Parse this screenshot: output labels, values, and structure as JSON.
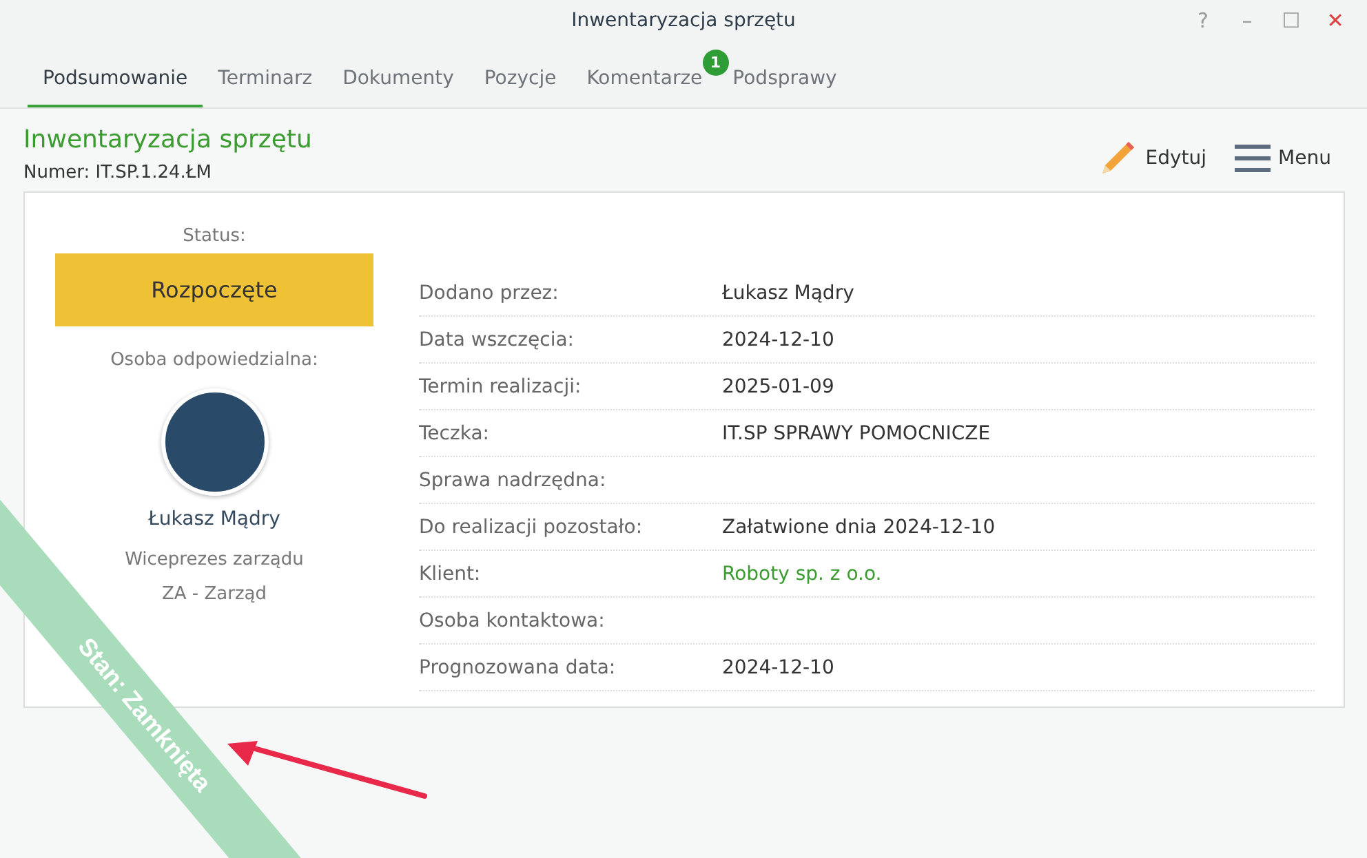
{
  "window": {
    "title": "Inwentaryzacja sprzętu",
    "controls": [
      "?",
      "–",
      "☐",
      "✕"
    ]
  },
  "tabs": [
    {
      "label": "Podsumowanie",
      "selected": true
    },
    {
      "label": "Terminarz",
      "selected": false
    },
    {
      "label": "Dokumenty",
      "selected": false
    },
    {
      "label": "Pozycje",
      "selected": false
    },
    {
      "label": "Komentarze",
      "selected": false,
      "badge": "1"
    },
    {
      "label": "Podsprawy",
      "selected": false
    }
  ],
  "header": {
    "title": "Inwentaryzacja sprzętu",
    "number": "Numer: IT.SP.1.24.ŁM",
    "actions": [
      {
        "kind": "edit",
        "label": "Edytuj"
      },
      {
        "kind": "menu",
        "label": "Menu"
      }
    ]
  },
  "summary": {
    "status_label": "Status:",
    "status": "Rozpoczęte",
    "owner_label": "Osoba odpowiedzialna:",
    "owner_name": "Łukasz Mądry",
    "owner_role": "Wiceprezes zarządu",
    "owner_department": "ZA - Zarząd"
  },
  "fields": [
    {
      "label": "Dodano przez:",
      "value": "Łukasz Mądry",
      "kind": "text"
    },
    {
      "label": "Data wszczęcia:",
      "value": "2024-12-10",
      "kind": "text"
    },
    {
      "label": "Termin realizacji:",
      "value": "2025-01-09",
      "kind": "text"
    },
    {
      "label": "Teczka:",
      "value": "IT.SP SPRAWY POMOCNICZE",
      "kind": "text"
    },
    {
      "label": "Sprawa nadrzędna:"
    },
    {
      "label": "Do realizacji pozostało:",
      "value": "Załatwione dnia 2024-12-10",
      "kind": "text"
    },
    {
      "label": "Klient:",
      "value": "Roboty sp. z o.o.",
      "kind": "link"
    },
    {
      "label": "Osoba kontaktowa:"
    },
    {
      "label": "Prognozowana data:",
      "value": "2024-12-10",
      "kind": "text"
    }
  ],
  "ribbon": {
    "label": "Stan: Zamknięta"
  }
}
